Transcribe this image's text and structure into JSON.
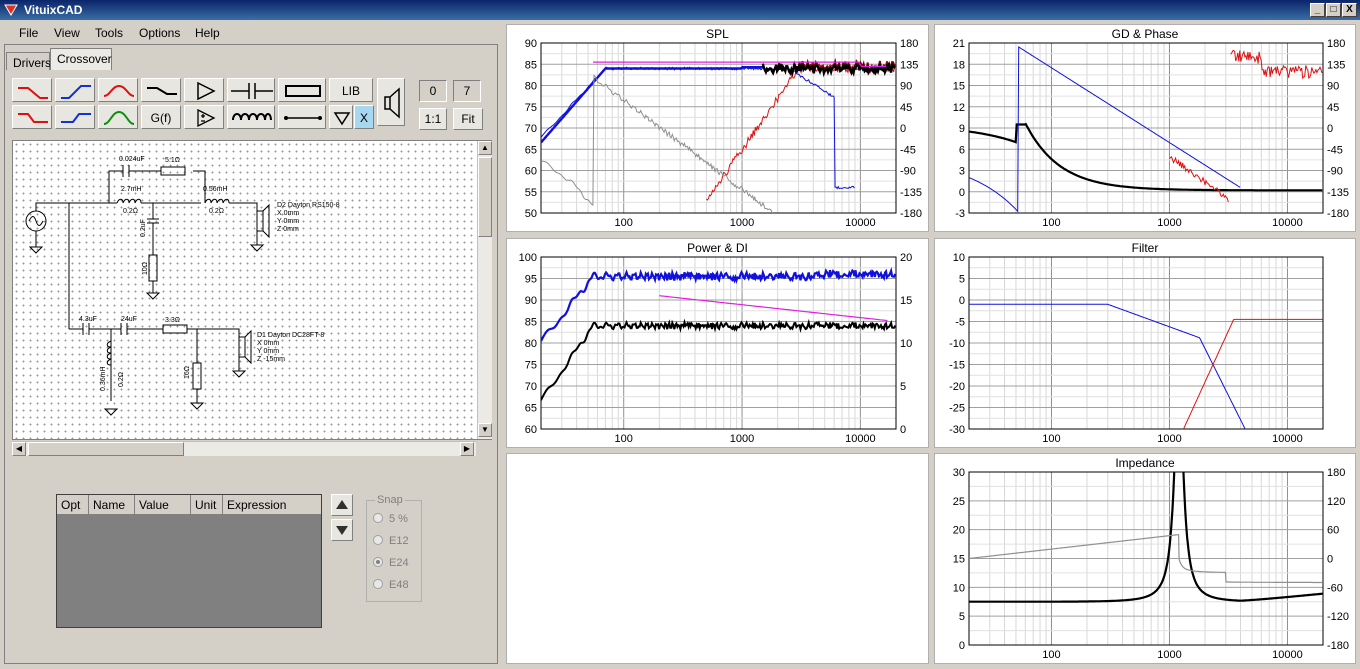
{
  "window": {
    "title": "VituixCAD",
    "min_label": "_",
    "max_label": "□",
    "close_label": "X"
  },
  "menu": [
    "File",
    "View",
    "Tools",
    "Options",
    "Help"
  ],
  "tabs": [
    "Drivers",
    "Crossover"
  ],
  "toolbar": {
    "lib_label": "LIB",
    "gf_label": "G(f)",
    "x_label": "X",
    "count_a": "0",
    "count_b": "7",
    "ratio_label": "1:1",
    "fit_label": "Fit"
  },
  "schematic": {
    "labels": {
      "c_top": "0.024uF",
      "r_top": "5.1Ω",
      "l_tw1": "2.7mH",
      "l_tw1_r": "0.2Ω",
      "l_tw2": "0.56mH",
      "l_tw2_r": "0.2Ω",
      "c_shunt": "0.2uF",
      "r_shunt": "10Ω",
      "driver2": "D2 Dayton RS150-8",
      "d2_x": "X 0mm",
      "d2_y": "Y 0mm",
      "d2_z": "Z 0mm",
      "c_w1": "4.3uF",
      "c_w2": "24uF",
      "r_w": "3.3Ω",
      "l_wsh": "0.36mH",
      "l_wsh_r": "0.2Ω",
      "r_wsh": "16Ω",
      "driver1": "D1 Dayton DC28FT-8",
      "d1_x": "X 0mm",
      "d1_y": "Y 0mm",
      "d1_z": "Z -15mm"
    }
  },
  "optimizer": {
    "columns": [
      "Opt",
      "Name",
      "Value",
      "Unit",
      "Expression"
    ]
  },
  "snap": {
    "legend": "Snap",
    "options": [
      "5 %",
      "E12",
      "E24",
      "E48"
    ],
    "selected": "E24"
  },
  "colors": {
    "blue": "#1010e0",
    "red": "#e01010",
    "black": "#000000",
    "magenta": "#e020e0",
    "gray": "#909090",
    "darkred": "#900000"
  },
  "graphs": {
    "spl": {
      "title": "SPL",
      "y_left": [
        "90",
        "85",
        "80",
        "75",
        "70",
        "65",
        "60",
        "55",
        "50"
      ],
      "y_right": [
        "180",
        "135",
        "90",
        "45",
        "0",
        "-45",
        "-90",
        "-135",
        "-180"
      ],
      "x_ticks": [
        "100",
        "1000",
        "10000"
      ]
    },
    "gd": {
      "title": "GD & Phase",
      "y_left": [
        "21",
        "18",
        "15",
        "12",
        "9",
        "6",
        "3",
        "0",
        "-3"
      ],
      "y_right": [
        "180",
        "135",
        "90",
        "45",
        "0",
        "-45",
        "-90",
        "-135",
        "-180"
      ],
      "x_ticks": [
        "100",
        "1000",
        "10000"
      ]
    },
    "power": {
      "title": "Power & DI",
      "y_left": [
        "100",
        "95",
        "90",
        "85",
        "80",
        "75",
        "70",
        "65",
        "60"
      ],
      "y_right": [
        "20",
        "15",
        "10",
        "5",
        "0"
      ],
      "x_ticks": [
        "100",
        "1000",
        "10000"
      ]
    },
    "filter": {
      "title": "Filter",
      "y_left": [
        "10",
        "5",
        "0",
        "-5",
        "-10",
        "-15",
        "-20",
        "-25",
        "-30"
      ],
      "x_ticks": [
        "100",
        "1000",
        "10000"
      ]
    },
    "impedance": {
      "title": "Impedance",
      "y_left": [
        "30",
        "25",
        "20",
        "15",
        "10",
        "5",
        "0"
      ],
      "y_right": [
        "180",
        "120",
        "60",
        "0",
        "-60",
        "-120",
        "-180"
      ],
      "x_ticks": [
        "100",
        "1000",
        "10000"
      ]
    }
  }
}
